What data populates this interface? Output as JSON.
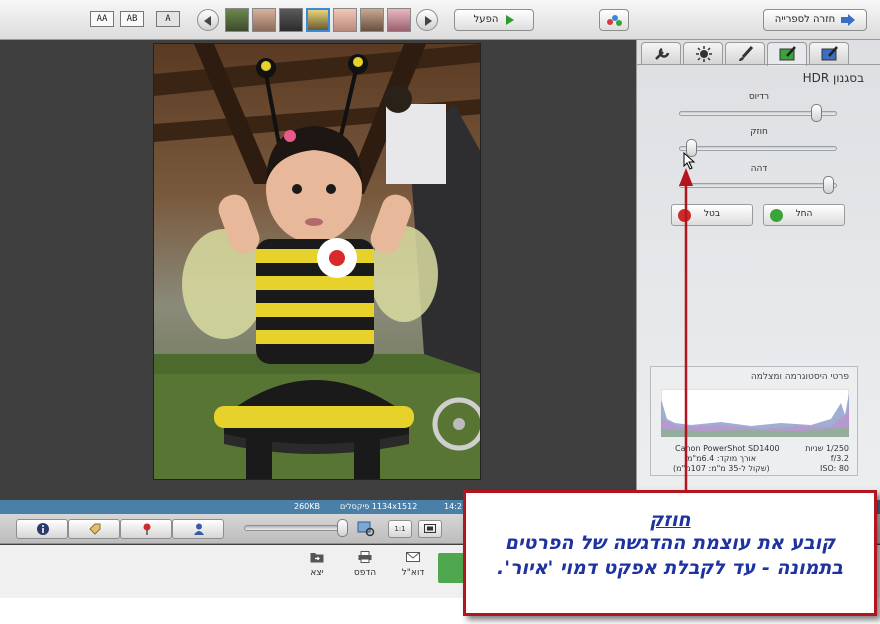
{
  "topbar": {
    "back_to_library": "חזרה לספרייה",
    "play": "הפעל",
    "view_toggles": [
      "AA",
      "AB",
      "A"
    ]
  },
  "panel": {
    "section_title": "בסגנון HDR",
    "sliders": [
      {
        "label": "רדיוס",
        "value": 0.9
      },
      {
        "label": "חוזק",
        "value": 0.05
      },
      {
        "label": "דהה",
        "value": 0.98
      }
    ],
    "apply_label": "החל",
    "cancel_label": "בטל",
    "histogram_title": "פרטי היסטוגרמה ומצלמה",
    "exif": {
      "camera": "Canon PowerShot SD1400",
      "shutter": "1/250 שניות",
      "focal": "אורך מוקד: 6.4מ\"מ",
      "aperture": "f/3.2",
      "equiv": "(שקול ל-35 מ\"מ: 107מ\"מ)",
      "iso": "ISO: 80"
    }
  },
  "status": {
    "filesize": "260KB",
    "dimensions": "1134x1512 פיקסלים",
    "time": "14:2"
  },
  "bottombar": {
    "zoom_value": 1.0,
    "fit_label": "1:1"
  },
  "actions": {
    "email": "דוא\"ל",
    "print": "הדפס",
    "export": "יצא"
  },
  "callout": {
    "title": "חוזק",
    "line1": "קובע את עוצמת ההדגשה של הפרטים",
    "line2": "בתמונה - עד לקבלת אפקט דמוי 'איור'."
  },
  "colors": {
    "status_bar": "#4a7fa8",
    "callout_border": "#b4141e",
    "callout_text": "#1e32a0",
    "apply_icon": "#3aa43a",
    "cancel_icon": "#cc2a2a"
  }
}
